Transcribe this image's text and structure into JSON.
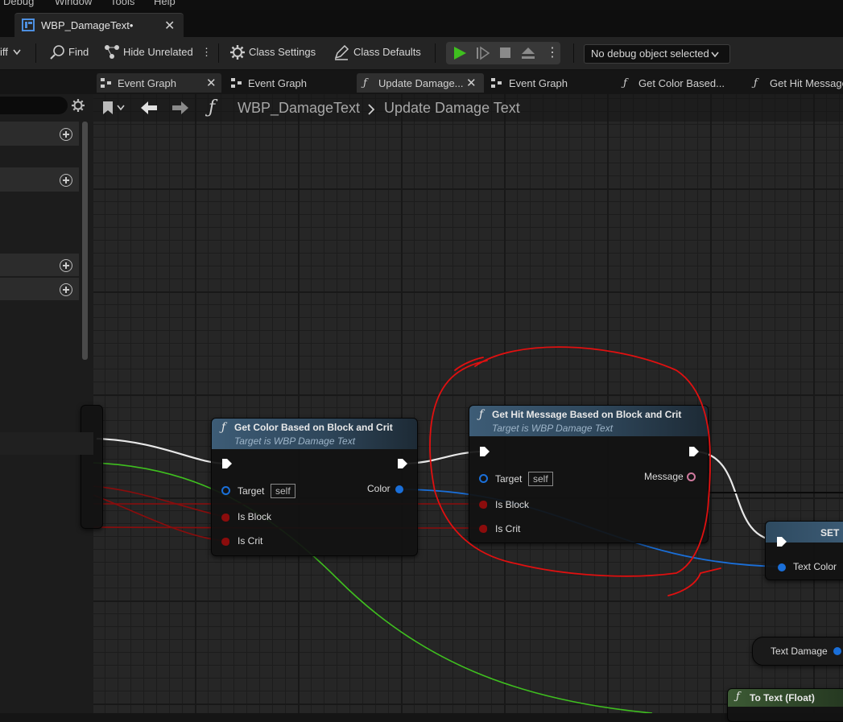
{
  "menu": [
    "Debug",
    "Window",
    "Tools",
    "Help"
  ],
  "document_tab": {
    "title": "WBP_DamageText•"
  },
  "toolbar": {
    "diff_label": "iff",
    "find_label": "Find",
    "hide_unrelated_label": "Hide Unrelated",
    "class_settings_label": "Class Settings",
    "class_defaults_label": "Class Defaults",
    "debug_object": "No debug object selected"
  },
  "graph_tabs": [
    {
      "label": "Event Graph",
      "active": false
    },
    {
      "label": "Event Graph",
      "active": false
    },
    {
      "label": "Update Damage...",
      "active": true
    },
    {
      "label": "Event Graph",
      "active": false
    },
    {
      "label": "Get Color Based...",
      "active": false
    },
    {
      "label": "Get Hit Message",
      "active": false
    }
  ],
  "breadcrumb": {
    "blueprint": "WBP_DamageText",
    "function": "Update Damage Text"
  },
  "nodes": {
    "get_color": {
      "title": "Get Color Based on Block and Crit",
      "subtitle": "Target is WBP Damage Text",
      "target_label": "Target",
      "target_value": "self",
      "is_block_label": "Is Block",
      "is_crit_label": "Is Crit",
      "output_label": "Color"
    },
    "get_hit_message": {
      "title": "Get Hit Message Based on Block and Crit",
      "subtitle": "Target is WBP Damage Text",
      "target_label": "Target",
      "target_value": "self",
      "is_block_label": "Is Block",
      "is_crit_label": "Is Crit",
      "output_label": "Message"
    },
    "set": {
      "title": "SET",
      "pin_label": "Text Color"
    },
    "text_damage": {
      "label": "Text Damage"
    },
    "to_text": {
      "title": "To Text (Float)"
    }
  },
  "colors": {
    "exec_wire": "#e8e8e8",
    "bool_wire": "#8b0c0c",
    "color_wire": "#1a6fd9",
    "float_wire": "#3fbf1f",
    "annotation": "#e01010"
  }
}
